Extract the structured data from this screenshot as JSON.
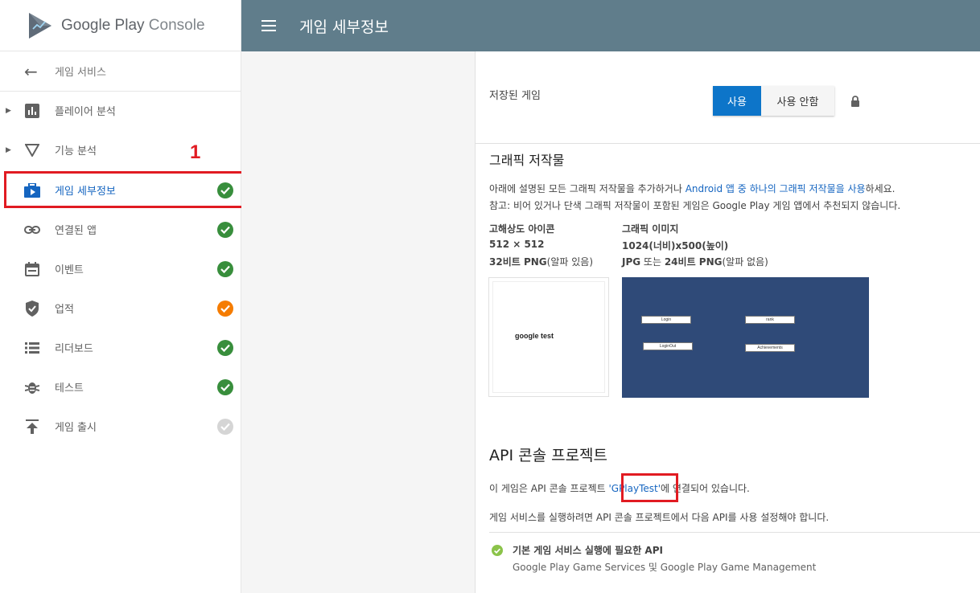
{
  "logo": {
    "brand": "Google Play",
    "product": "Console"
  },
  "header": {
    "title": "게임 세부정보"
  },
  "sidebar": {
    "back_label": "게임 서비스",
    "step_marker": "1",
    "items": [
      {
        "label": "플레이어 분석",
        "icon": "bar-chart-icon",
        "caret": true,
        "status": ""
      },
      {
        "label": "기능 분석",
        "icon": "funnel-icon",
        "caret": true,
        "status": ""
      },
      {
        "label": "게임 세부정보",
        "icon": "briefcase-play-icon",
        "caret": false,
        "status": "complete",
        "active": true
      },
      {
        "label": "연결된 앱",
        "icon": "link-icon",
        "caret": false,
        "status": "complete"
      },
      {
        "label": "이벤트",
        "icon": "calendar-icon",
        "caret": false,
        "status": "complete"
      },
      {
        "label": "업적",
        "icon": "shield-check-icon",
        "caret": false,
        "status": "warning"
      },
      {
        "label": "리더보드",
        "icon": "list-icon",
        "caret": false,
        "status": "complete"
      },
      {
        "label": "테스트",
        "icon": "bug-icon",
        "caret": false,
        "status": "complete"
      },
      {
        "label": "게임 출시",
        "icon": "publish-icon",
        "caret": false,
        "status": "inactive"
      }
    ]
  },
  "saved_games": {
    "label": "저장된 게임",
    "on_label": "사용",
    "off_label": "사용 안함"
  },
  "graphics": {
    "title": "그래픽 저작물",
    "desc1_pre": "아래에 설명된 모든 그래픽 저작물을 추가하거나 ",
    "desc1_link": "Android 앱 중 하나의 그래픽 저작물을 사용",
    "desc1_post": "하세요.",
    "desc2": "참고: 비어 있거나 단색 그래픽 저작물이 포함된 게임은 Google Play 게임 앱에서 추천되지 않습니다.",
    "icon_title": "고해상도 아이콘",
    "icon_size": "512 × 512",
    "icon_fmt_bold": "32비트 PNG",
    "icon_fmt_rest": "(알파 있음)",
    "feature_title": "그래픽 이미지",
    "feature_size": "1024(너비)x500(높이)",
    "feature_fmt_a": "JPG",
    "feature_fmt_mid": " 또는 ",
    "feature_fmt_b": "24비트 PNG",
    "feature_fmt_rest": "(알파 없음)",
    "icon_preview_text": "google test",
    "feature_buttons": [
      "Login",
      "rank",
      "LoginOut",
      "Achievements"
    ]
  },
  "api": {
    "title": "API 콘솔 프로젝트",
    "linked_pre": "이 게임은 API 콘솔 프로젝트 ",
    "linked_link": "'GPlayTest'",
    "linked_post": "에 연결되어 있습니다.",
    "enable_note": "게임 서비스를 실행하려면 API 콘솔 프로젝트에서 다음 API를 사용 설정해야 합니다.",
    "req_title": "기본 게임 서비스 실행에 필요한 API",
    "req_apis": "Google Play Game Services 및 Google Play Game Management"
  }
}
